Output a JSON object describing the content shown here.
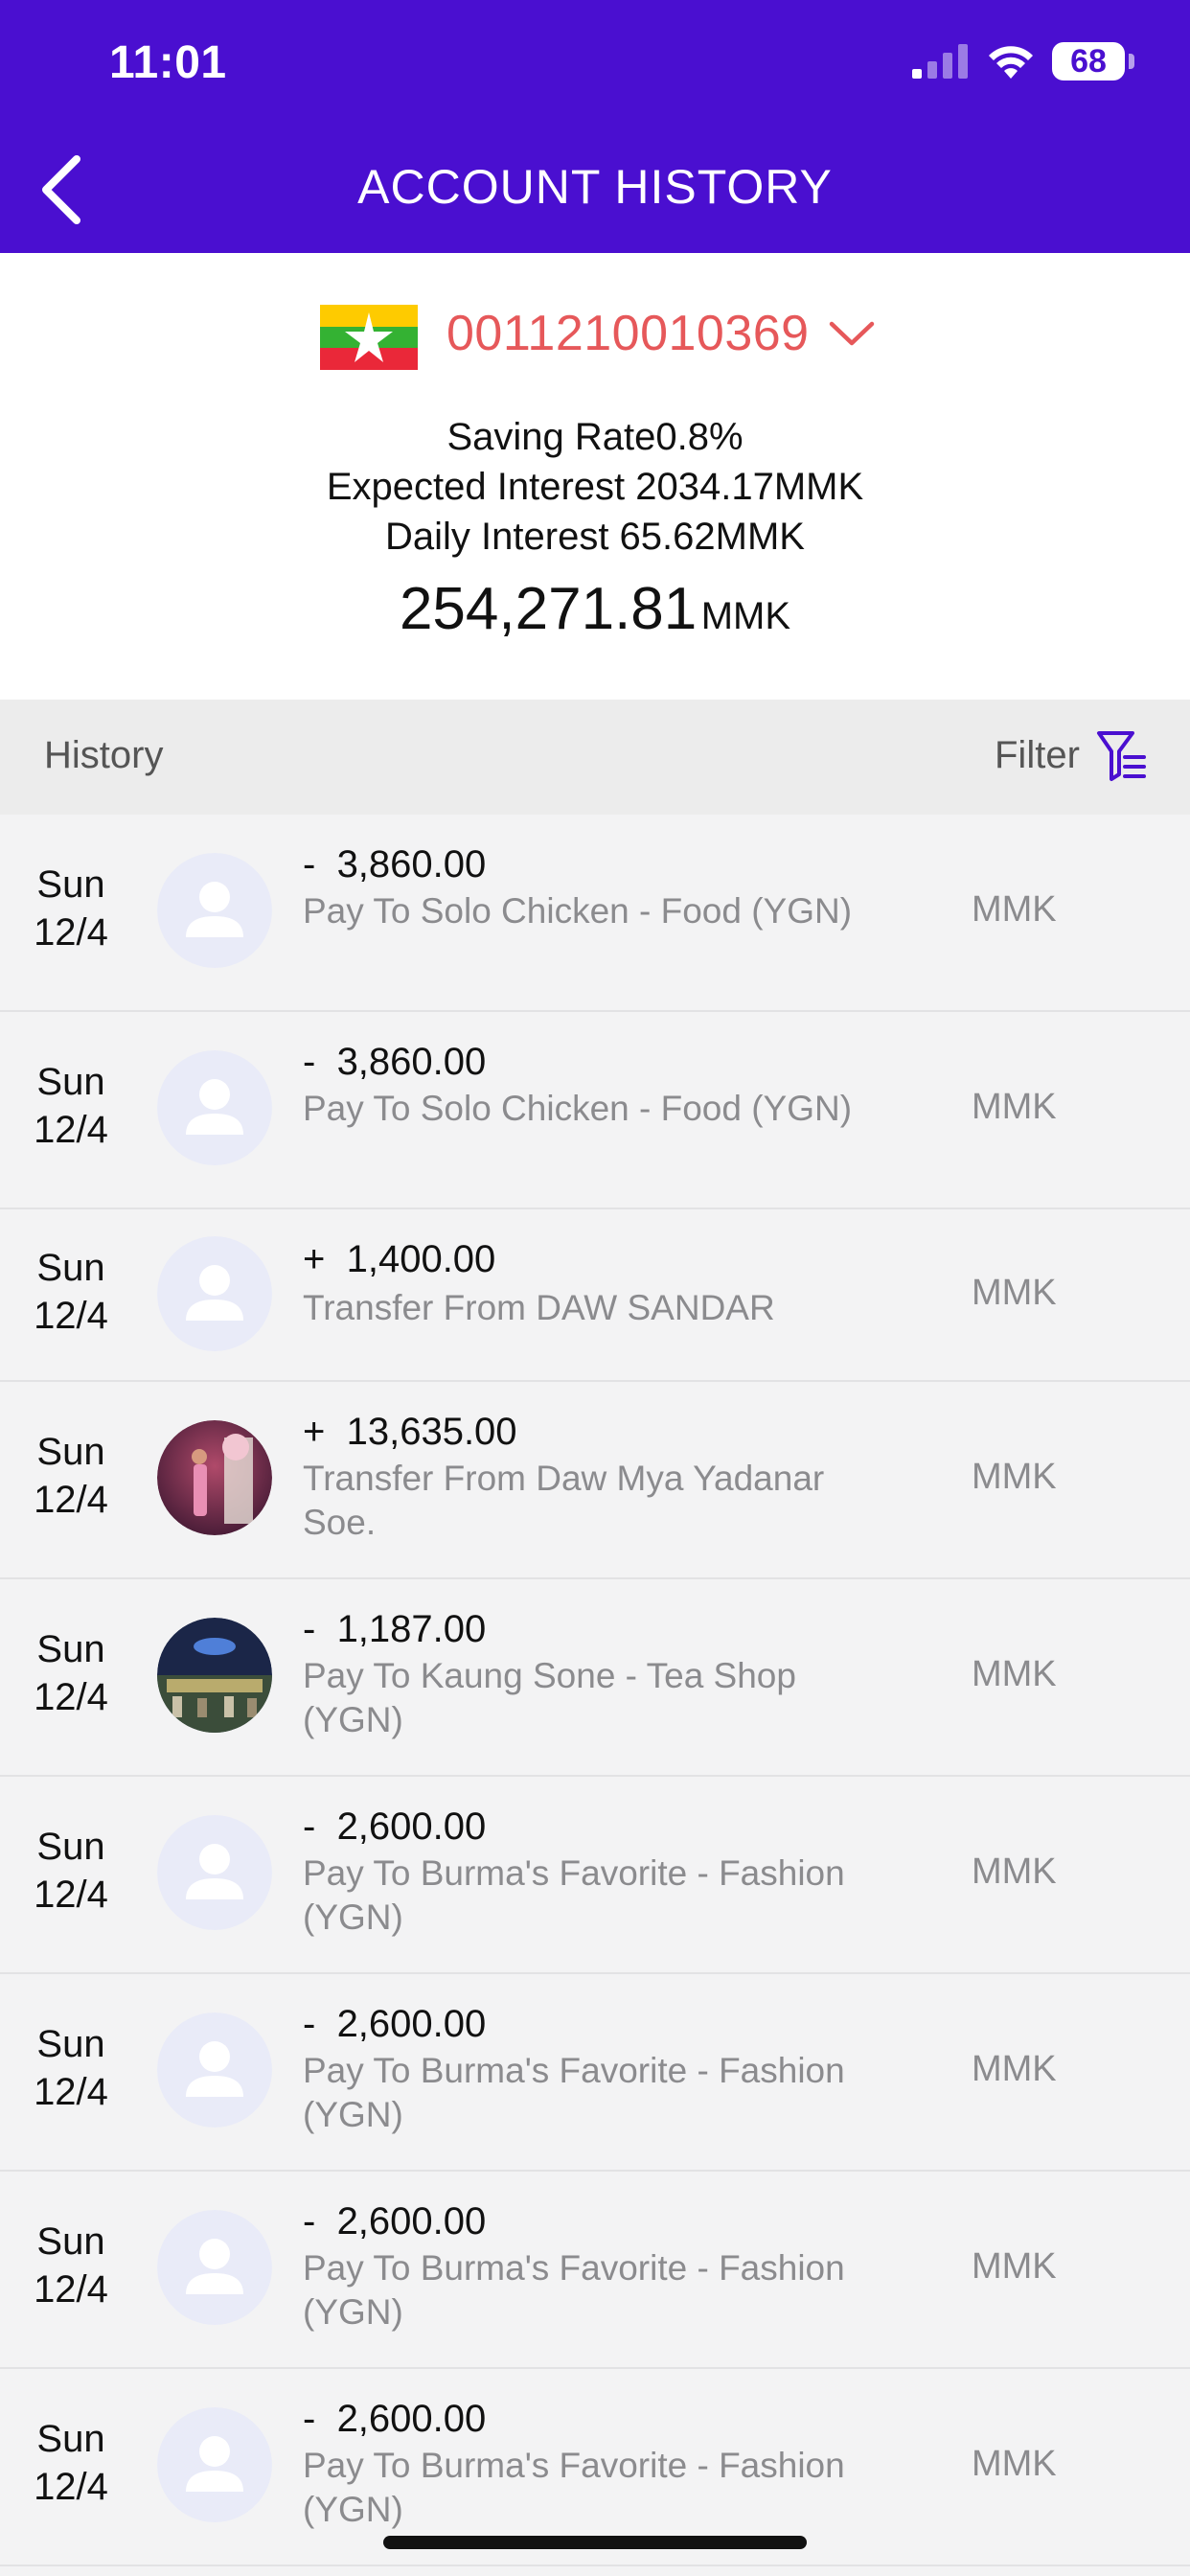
{
  "status_bar": {
    "time": "11:01",
    "battery": "68"
  },
  "header": {
    "title": "ACCOUNT HISTORY",
    "back_icon": "chevron-left-icon"
  },
  "account": {
    "number": "0011210010369",
    "flag": "myanmar-flag",
    "saving_rate": "Saving  Rate0.8%",
    "expected_interest": "Expected Interest 2034.17MMK",
    "daily_interest": "Daily Interest 65.62MMK",
    "balance_amount": "254,271.81",
    "balance_unit": "MMK"
  },
  "history": {
    "label": "History",
    "filter_label": "Filter"
  },
  "transactions": [
    {
      "day": "Sun",
      "date": "12/4",
      "sign": "-",
      "amount": "3,860.00",
      "desc": "Pay To Solo Chicken - Food (YGN)",
      "currency": "MMK",
      "avatar": "placeholder"
    },
    {
      "day": "Sun",
      "date": "12/4",
      "sign": "-",
      "amount": "3,860.00",
      "desc": "Pay To Solo Chicken - Food (YGN)",
      "currency": "MMK",
      "avatar": "placeholder"
    },
    {
      "day": "Sun",
      "date": "12/4",
      "sign": "+",
      "amount": "1,400.00",
      "desc": "Transfer From DAW SANDAR",
      "currency": "MMK",
      "avatar": "placeholder"
    },
    {
      "day": "Sun",
      "date": "12/4",
      "sign": "+",
      "amount": "13,635.00",
      "desc": "Transfer From Daw Mya Yadanar Soe.",
      "currency": "MMK",
      "avatar": "photo-person"
    },
    {
      "day": "Sun",
      "date": "12/4",
      "sign": "-",
      "amount": "1,187.00",
      "desc": "Pay To Kaung Sone - Tea Shop (YGN)",
      "currency": "MMK",
      "avatar": "photo-shop"
    },
    {
      "day": "Sun",
      "date": "12/4",
      "sign": "-",
      "amount": "2,600.00",
      "desc": "Pay To Burma's Favorite - Fashion (YGN)",
      "currency": "MMK",
      "avatar": "placeholder"
    },
    {
      "day": "Sun",
      "date": "12/4",
      "sign": "-",
      "amount": "2,600.00",
      "desc": "Pay To Burma's Favorite - Fashion (YGN)",
      "currency": "MMK",
      "avatar": "placeholder"
    },
    {
      "day": "Sun",
      "date": "12/4",
      "sign": "-",
      "amount": "2,600.00",
      "desc": "Pay To Burma's Favorite - Fashion (YGN)",
      "currency": "MMK",
      "avatar": "placeholder"
    },
    {
      "day": "Sun",
      "date": "12/4",
      "sign": "-",
      "amount": "2,600.00",
      "desc": "Pay To Burma's Favorite - Fashion (YGN)",
      "currency": "MMK",
      "avatar": "placeholder"
    }
  ],
  "colors": {
    "brand": "#4a0fd0",
    "account_number": "#e6585a",
    "muted_text": "#8b8b8e"
  }
}
